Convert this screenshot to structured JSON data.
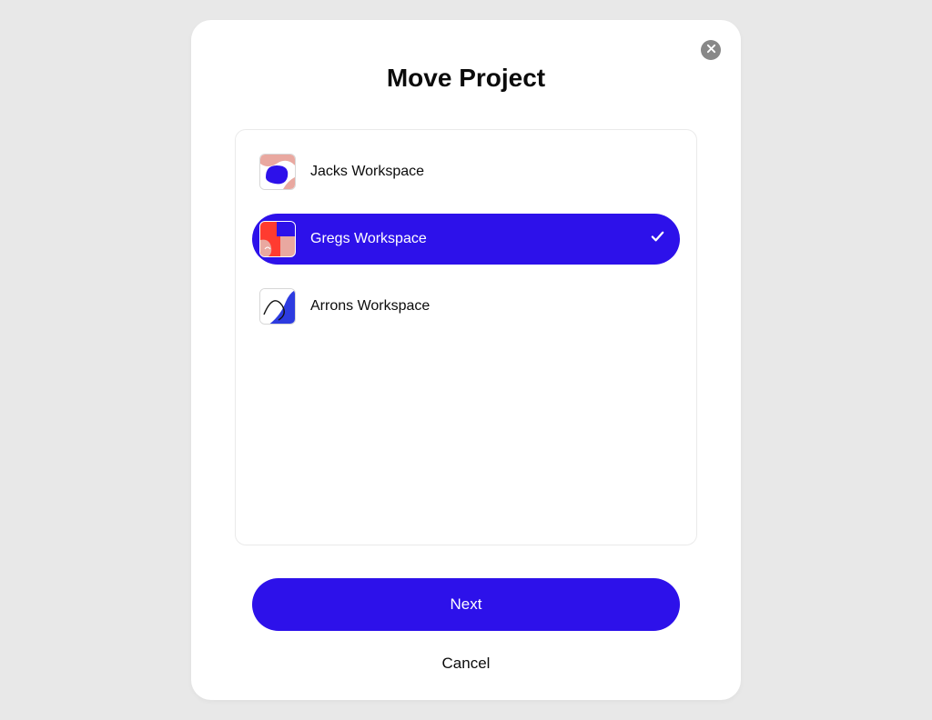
{
  "dialog": {
    "title": "Move Project",
    "next_label": "Next",
    "cancel_label": "Cancel"
  },
  "workspaces": [
    {
      "label": "Jacks Workspace",
      "selected": false
    },
    {
      "label": "Gregs Workspace",
      "selected": true
    },
    {
      "label": "Arrons Workspace",
      "selected": false
    }
  ],
  "colors": {
    "accent": "#2d11ea",
    "page_bg": "#e8e8e8",
    "close_bg": "#888888"
  }
}
